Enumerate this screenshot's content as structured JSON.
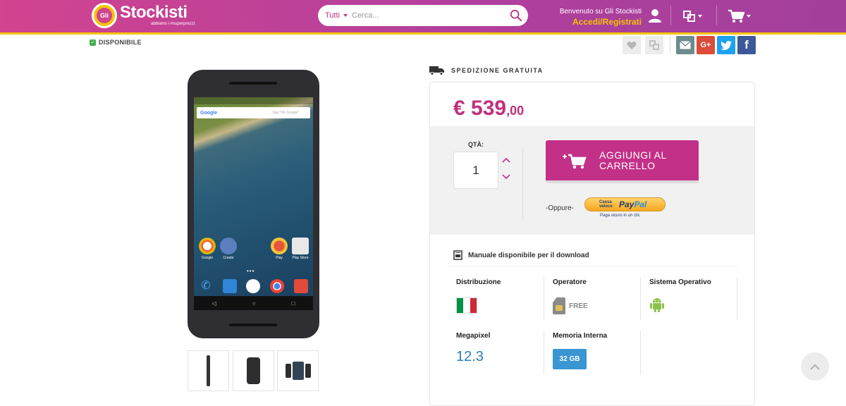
{
  "header": {
    "logo_name": "Stockisti",
    "logo_tagline": "abbiamo i #superprezzi.",
    "logo_badge": "Gli",
    "search": {
      "category": "Tutti",
      "placeholder": "Cerca..."
    },
    "welcome_line": "Benvenuto su Gli Stockisti",
    "login_link": "Accedi/Registrati"
  },
  "availability": "DISPONIBILE",
  "gallery": {
    "thumbnails": [
      "side",
      "back",
      "trio"
    ]
  },
  "phone_screen": {
    "search_logo": "Google",
    "search_hint": "Say \"Ok Google\"",
    "apps": [
      "Google",
      "Create",
      "Play",
      "Play Store"
    ]
  },
  "shipping": "SPEDIZIONE GRATUITA",
  "price": {
    "main": "€ 539",
    "cents": ",00"
  },
  "cart": {
    "qty_label": "QTÀ:",
    "qty_value": "1",
    "add_button": "AGGIUNGI AL CARRELLO",
    "or_text": "-Oppure-",
    "paypal_small": "Cassa veloce",
    "paypal_logo_a": "Pay",
    "paypal_logo_b": "Pal",
    "paypal_note": "Paga sicuro in un clic"
  },
  "manual": "Manuale disponibile per il download",
  "specs": {
    "distribuzione": "Distribuzione",
    "operatore": "Operatore",
    "operatore_value": "FREE",
    "sistema": "Sistema Operativo",
    "megapixel": "Megapixel",
    "megapixel_value": "12.3",
    "memoria": "Memoria Interna",
    "memoria_value": "32 GB"
  },
  "colors": {
    "brand": "#c33088",
    "accent_yellow": "#f5c400",
    "link_blue": "#2980b9"
  },
  "icons": {
    "wishlist": "heart-icon",
    "compare": "compare-icon",
    "email": "email-icon",
    "gplus": "google-plus-icon",
    "twitter": "twitter-icon",
    "facebook": "facebook-icon"
  }
}
